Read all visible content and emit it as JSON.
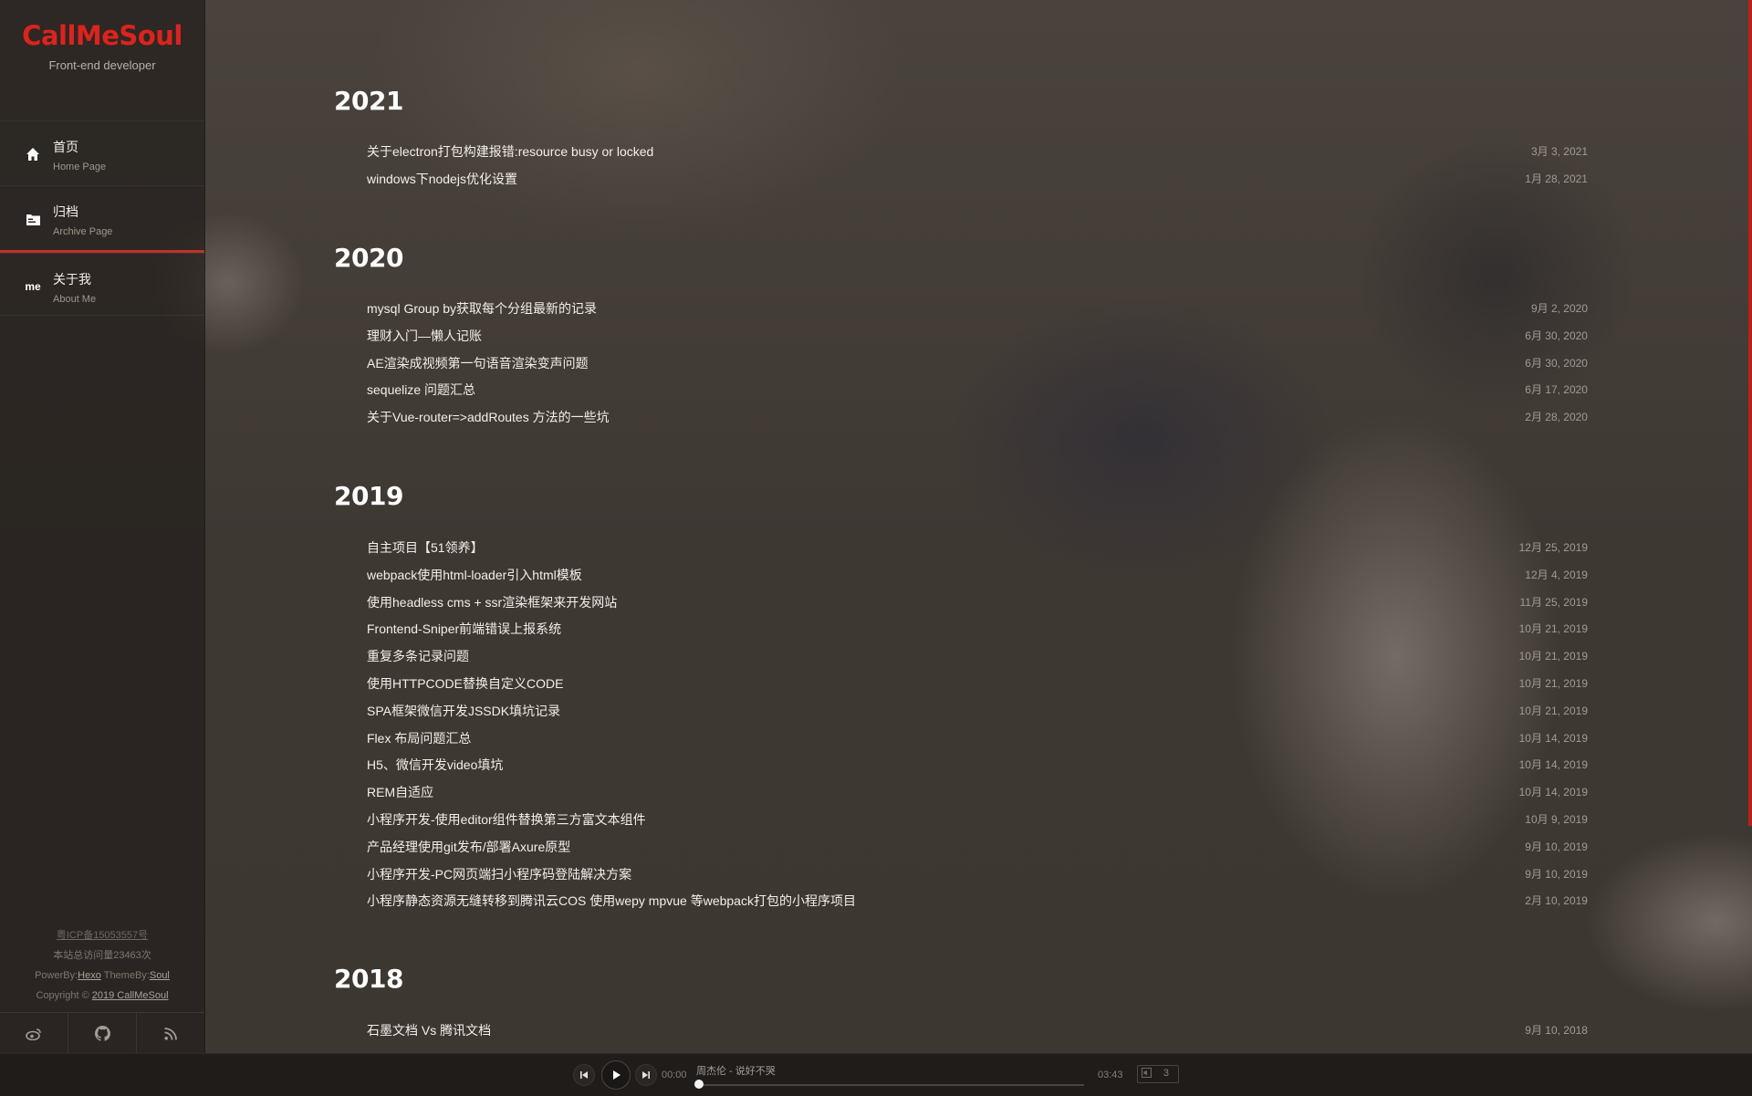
{
  "site": {
    "logo": "CallMeSoul",
    "tagline": "Front-end developer"
  },
  "nav": [
    {
      "title": "首页",
      "sub": "Home Page",
      "icon": "home-icon"
    },
    {
      "title": "归档",
      "sub": "Archive Page",
      "icon": "archive-icon",
      "active": true
    },
    {
      "title": "关于我",
      "sub": "About Me",
      "icon": "me-icon",
      "icon_text": "me"
    }
  ],
  "footer": {
    "icp": "粤ICP备15053557号",
    "visits": "本站总访问量23463次",
    "powered_prefix": "PowerBy:",
    "powered_link": "Hexo",
    "theme_prefix": "ThemeBy:",
    "theme_link": "Soul",
    "copyright_prefix": "Copyright © ",
    "copyright_link": "2019 CallMeSoul"
  },
  "social": [
    "weibo-icon",
    "github-icon",
    "rss-icon"
  ],
  "archive": [
    {
      "year": "2021",
      "posts": [
        {
          "title": "关于electron打包构建报错:resource busy or locked",
          "date": "3月 3, 2021"
        },
        {
          "title": "windows下nodejs优化设置",
          "date": "1月 28, 2021"
        }
      ]
    },
    {
      "year": "2020",
      "posts": [
        {
          "title": "mysql Group by获取每个分组最新的记录",
          "date": "9月 2, 2020"
        },
        {
          "title": "理财入门—懒人记账",
          "date": "6月 30, 2020"
        },
        {
          "title": "AE渲染成视频第一句语音渲染变声问题",
          "date": "6月 30, 2020"
        },
        {
          "title": "sequelize 问题汇总",
          "date": "6月 17, 2020"
        },
        {
          "title": "关于Vue-router=>addRoutes 方法的一些坑",
          "date": "2月 28, 2020"
        }
      ]
    },
    {
      "year": "2019",
      "posts": [
        {
          "title": "自主项目【51领养】",
          "date": "12月 25, 2019"
        },
        {
          "title": "webpack使用html-loader引入html模板",
          "date": "12月 4, 2019"
        },
        {
          "title": "使用headless cms + ssr渲染框架来开发网站",
          "date": "11月 25, 2019"
        },
        {
          "title": "Frontend-Sniper前端错误上报系统",
          "date": "10月 21, 2019"
        },
        {
          "title": "重复多条记录问题",
          "date": "10月 21, 2019"
        },
        {
          "title": "使用HTTPCODE替换自定义CODE",
          "date": "10月 21, 2019"
        },
        {
          "title": "SPA框架微信开发JSSDK填坑记录",
          "date": "10月 21, 2019"
        },
        {
          "title": "Flex 布局问题汇总",
          "date": "10月 14, 2019"
        },
        {
          "title": "H5、微信开发video填坑",
          "date": "10月 14, 2019"
        },
        {
          "title": "REM自适应",
          "date": "10月 14, 2019"
        },
        {
          "title": "小程序开发-使用editor组件替换第三方富文本组件",
          "date": "10月 9, 2019"
        },
        {
          "title": "产品经理使用git发布/部署Axure原型",
          "date": "9月 10, 2019"
        },
        {
          "title": "小程序开发-PC网页端扫小程序码登陆解决方案",
          "date": "9月 10, 2019"
        },
        {
          "title": "小程序静态资源无缝转移到腾讯云COS 使用wepy mpvue 等webpack打包的小程序项目",
          "date": "2月 10, 2019"
        }
      ]
    },
    {
      "year": "2018",
      "posts": [
        {
          "title": "石墨文档 Vs 腾讯文档",
          "date": "9月 10, 2018"
        }
      ]
    }
  ],
  "player": {
    "current_time": "00:00",
    "song": "周杰伦 - 说好不哭",
    "total_time": "03:43",
    "volume": "3",
    "progress": 0
  },
  "colors": {
    "accent": "#d8251f",
    "active_border": "#c0302a"
  }
}
